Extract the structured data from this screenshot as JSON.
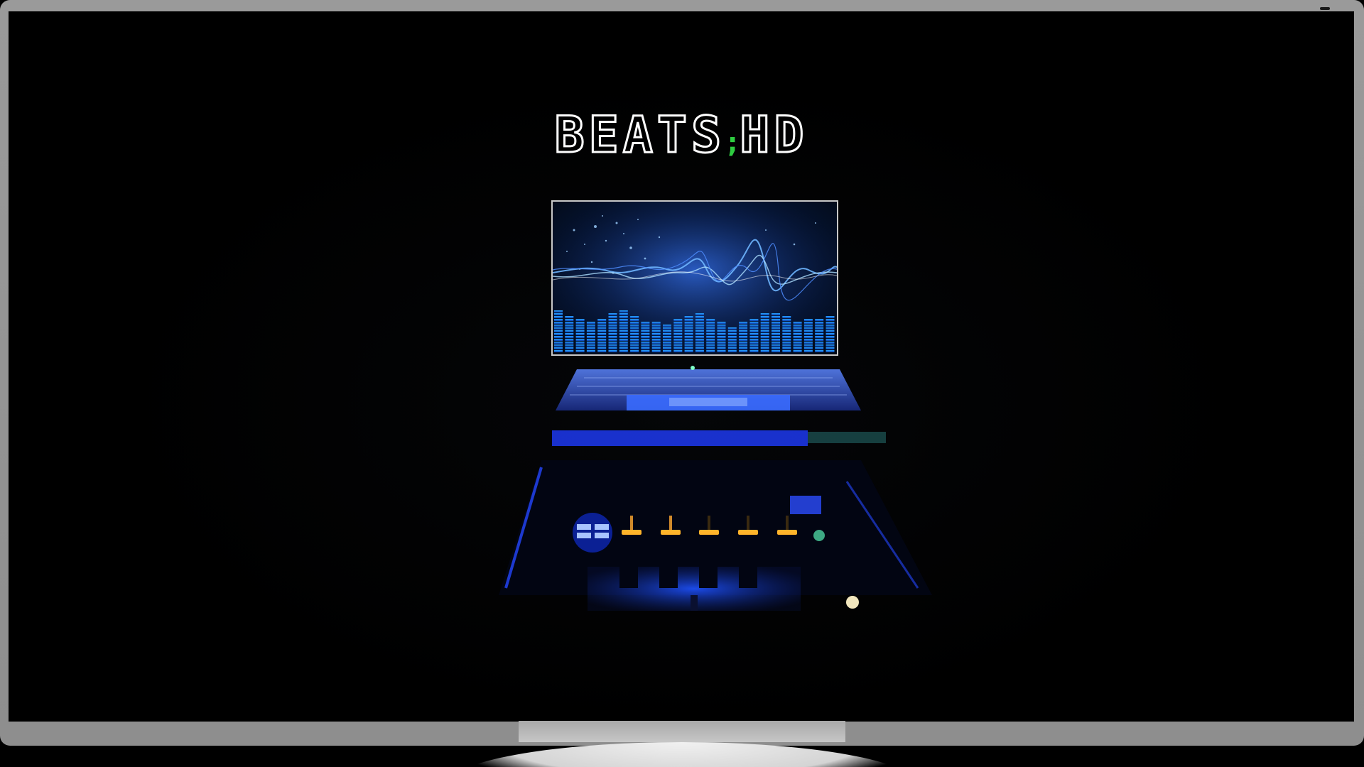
{
  "logo": {
    "part1": "BEATS",
    "separator": ";",
    "part2": "HD"
  },
  "colors": {
    "background": "#000000",
    "frame": "#9a9a9a",
    "logo_stroke": "#ffffff",
    "logo_accent": "#2ecc40",
    "glow_blue": "#1a4dff"
  },
  "scene": {
    "waveform_panel": "audio-waveform-equalizer",
    "gear": "dj-controller-laptop"
  }
}
